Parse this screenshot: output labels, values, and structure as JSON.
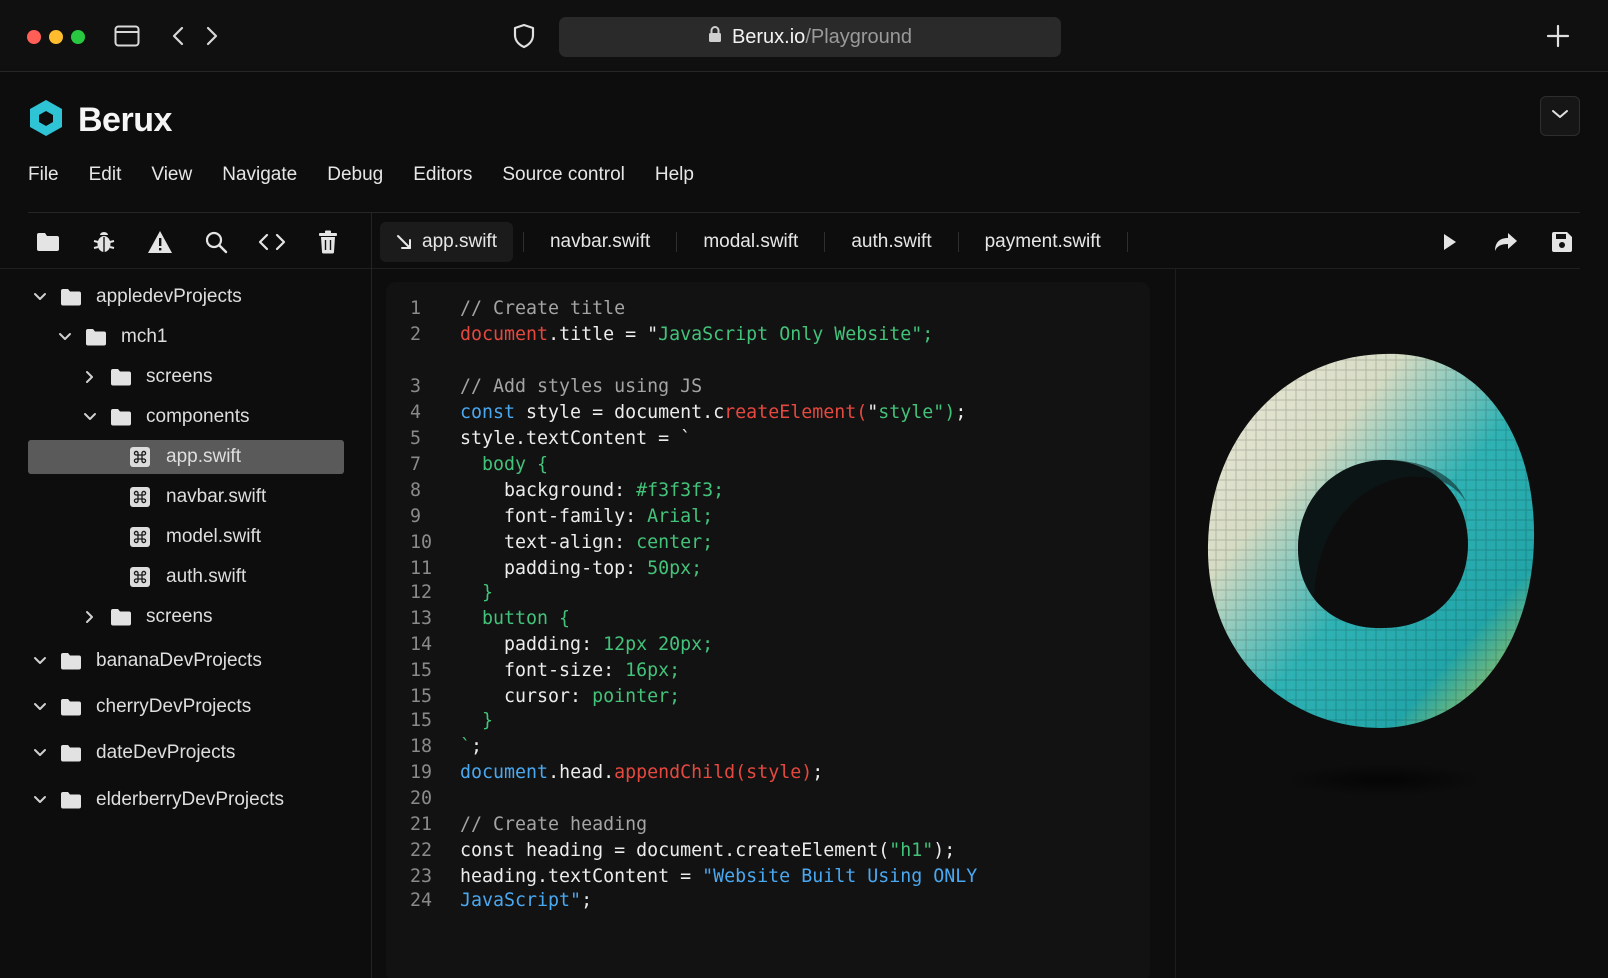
{
  "browser": {
    "url_host": "Berux.io",
    "url_path": "/Playground",
    "traffic_lights": [
      "#ff5f57",
      "#febc2e",
      "#28c840"
    ]
  },
  "app": {
    "name": "Berux",
    "accent": "#2ec4d6"
  },
  "menu": [
    "File",
    "Edit",
    "View",
    "Navigate",
    "Debug",
    "Editors",
    "Source control",
    "Help"
  ],
  "toolbar_icons": [
    "folder-icon",
    "bug-icon",
    "warning-icon",
    "search-icon",
    "code-icon",
    "trash-icon"
  ],
  "tree": [
    {
      "label": "appledevProjects",
      "kind": "folder",
      "expanded": true
    },
    {
      "label": "mch1",
      "kind": "folder",
      "expanded": true
    },
    {
      "label": "screens",
      "kind": "folder",
      "expanded": false
    },
    {
      "label": "components",
      "kind": "folder",
      "expanded": true
    },
    {
      "label": "app.swift",
      "kind": "file",
      "selected": true
    },
    {
      "label": "navbar.swift",
      "kind": "file"
    },
    {
      "label": "model.swift",
      "kind": "file"
    },
    {
      "label": "auth.swift",
      "kind": "file"
    },
    {
      "label": "screens",
      "kind": "folder",
      "expanded": false
    },
    {
      "label": "bananaDevProjects",
      "kind": "folder",
      "expanded": true
    },
    {
      "label": "cherryDevProjects",
      "kind": "folder",
      "expanded": true
    },
    {
      "label": "dateDevProjects",
      "kind": "folder",
      "expanded": true
    },
    {
      "label": "elderberryDevProjects",
      "kind": "folder",
      "expanded": true
    }
  ],
  "tabs": [
    {
      "label": "app.swift",
      "active": true
    },
    {
      "label": "navbar.swift"
    },
    {
      "label": "modal.swift"
    },
    {
      "label": "auth.swift"
    },
    {
      "label": "payment.swift"
    }
  ],
  "run_icons": [
    "play-icon",
    "share-icon",
    "save-icon"
  ],
  "code": {
    "line_numbers": [
      "1",
      "2",
      "3",
      "4",
      "5",
      "7",
      "8",
      "9",
      "10",
      "11",
      "12",
      "13",
      "14",
      "15",
      "15",
      "15",
      "18",
      "19",
      "20",
      "21",
      "22",
      "23",
      "24"
    ],
    "lines": [
      "// Create title",
      "document.title = \"JavaScript Only Website\";",
      "// Add styles using JS",
      "const style = document.createElement(\"style\");",
      "style.textContent = `",
      "  body {",
      "    background: #f3f3f3;",
      "    font-family: Arial;",
      "    text-align: center;",
      "    padding-top: 50px;",
      "  }",
      "  button {",
      "    padding: 12px 20px;",
      "    font-size: 16px;",
      "    cursor: pointer;",
      "  }",
      "`;",
      "document.head.appendChild(style);",
      "",
      "// Create heading",
      "const heading = document.createElement(\"h1\");",
      "heading.textContent = \"Website Built Using ONLY",
      "JavaScript\";"
    ]
  }
}
